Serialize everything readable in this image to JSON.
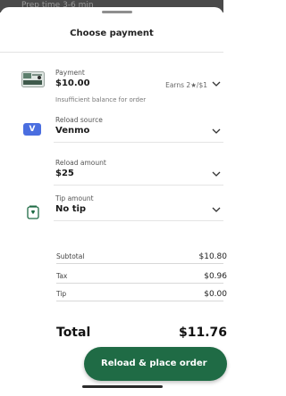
{
  "backdrop": {
    "text": "Prep time 3-6 min"
  },
  "sheet": {
    "title": "Choose payment"
  },
  "payment": {
    "label": "Payment",
    "value": "$10.00",
    "earns": "Earns 2★/$1",
    "note": "Insufficient balance for order"
  },
  "reload_source": {
    "label": "Reload source",
    "value": "Venmo",
    "icon_letter": "V"
  },
  "reload_amount": {
    "label": "Reload amount",
    "value": "$25"
  },
  "tip_amount": {
    "label": "Tip amount",
    "value": "No tip"
  },
  "summary": {
    "subtotal_label": "Subtotal",
    "subtotal_value": "$10.80",
    "tax_label": "Tax",
    "tax_value": "$0.96",
    "tip_label": "Tip",
    "tip_value": "$0.00",
    "total_label": "Total",
    "total_value": "$11.76"
  },
  "cta": {
    "label": "Reload & place order"
  },
  "colors": {
    "accent": "#1f6b45",
    "venmo": "#4a6ee0"
  },
  "icons": [
    "card-icon",
    "venmo-icon",
    "tip-jar-icon",
    "chevron-down-icon"
  ]
}
